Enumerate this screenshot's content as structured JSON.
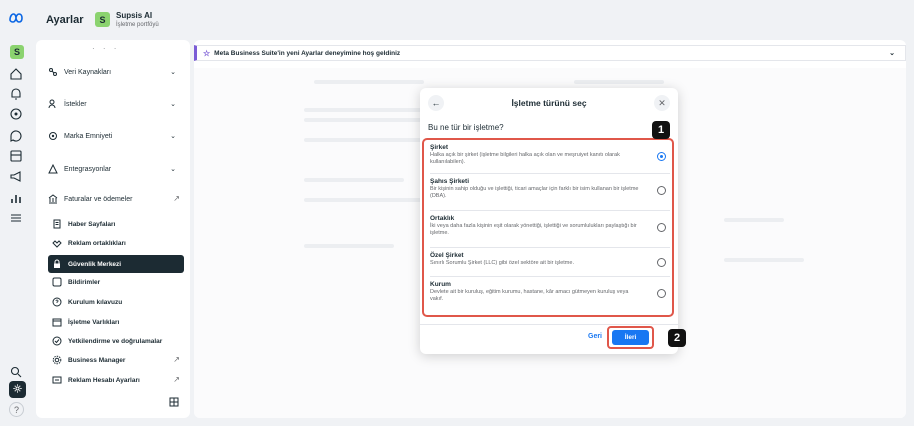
{
  "header": {
    "title": "Ayarlar",
    "business_initial": "S",
    "business_name": "Supsis AI",
    "business_subtitle": "İşletme portföyü"
  },
  "rail": {
    "account_initial": "S",
    "icons": [
      "meta-logo-icon",
      "home-icon",
      "bell-icon",
      "target-icon",
      "chat-bubble-icon",
      "pages-icon",
      "megaphone-icon",
      "analytics-icon",
      "menu-icon",
      "search-icon",
      "gear-icon",
      "help-icon"
    ],
    "help_label": "?"
  },
  "sidebar": {
    "dots": "· · ·",
    "groups": [
      {
        "label": "Veri Kaynakları",
        "chevron": "⌄"
      },
      {
        "label": "İstekler",
        "chevron": "⌄"
      },
      {
        "label": "Marka Emniyeti",
        "chevron": "⌄"
      },
      {
        "label": "Entegrasyonlar",
        "chevron": "⌄"
      },
      {
        "label": "Faturalar ve ödemeler",
        "chevron": "↗"
      }
    ],
    "sub_items": [
      {
        "label": "Haber Sayfaları"
      },
      {
        "label": "Reklam ortaklıkları"
      },
      {
        "label": "Güvenlik Merkezi",
        "active": true
      },
      {
        "label": "Bildirimler"
      },
      {
        "label": "Kurulum kılavuzu"
      },
      {
        "label": "İşletme Varlıkları"
      },
      {
        "label": "Yetkilendirme ve doğrulamalar"
      },
      {
        "label": "Business Manager",
        "external": "↗"
      },
      {
        "label": "Reklam Hesabı Ayarları",
        "external": "↗"
      }
    ]
  },
  "main": {
    "welcome_text": "Meta Business Suite'in yeni Ayarlar deneyimine hoş geldiniz",
    "welcome_chevron": "⌄"
  },
  "modal": {
    "title": "İşletme türünü seç",
    "back_glyph": "←",
    "close_glyph": "✕",
    "question": "Bu ne tür bir işletme?",
    "options": [
      {
        "title": "Şirket",
        "desc": "Halka açık bir şirket (işletme bilgileri halka açık olan ve meşruiyet kanıtı olarak kullanılabilen).",
        "selected": true
      },
      {
        "title": "Şahıs Şirketi",
        "desc": "Bir kişinin sahip olduğu ve işlettiği, ticari amaçlar için farklı bir isim kullanan bir işletme (DBA).",
        "selected": false
      },
      {
        "title": "Ortaklık",
        "desc": "İki veya daha fazla kişinin eşit olarak yönettiği, işlettiği ve sorumlulukları paylaştığı bir işletme.",
        "selected": false
      },
      {
        "title": "Özel Şirket",
        "desc": "Sınırlı Sorumlu Şirket (LLC) gibi özel sektöre ait bir işletme.",
        "selected": false
      },
      {
        "title": "Kurum",
        "desc": "Devlete ait bir kuruluş, eğitim kurumu, hastane, kâr amacı gütmeyen kuruluş veya vakıf.",
        "selected": false
      }
    ],
    "back_button": "Geri",
    "next_button": "İleri"
  },
  "annotations": {
    "badge_1": "1",
    "badge_2": "2"
  },
  "colors": {
    "accent": "#1877f2",
    "highlight": "#e0574a",
    "active_bg": "#1c2b33",
    "brand_green": "#8bd36f"
  }
}
